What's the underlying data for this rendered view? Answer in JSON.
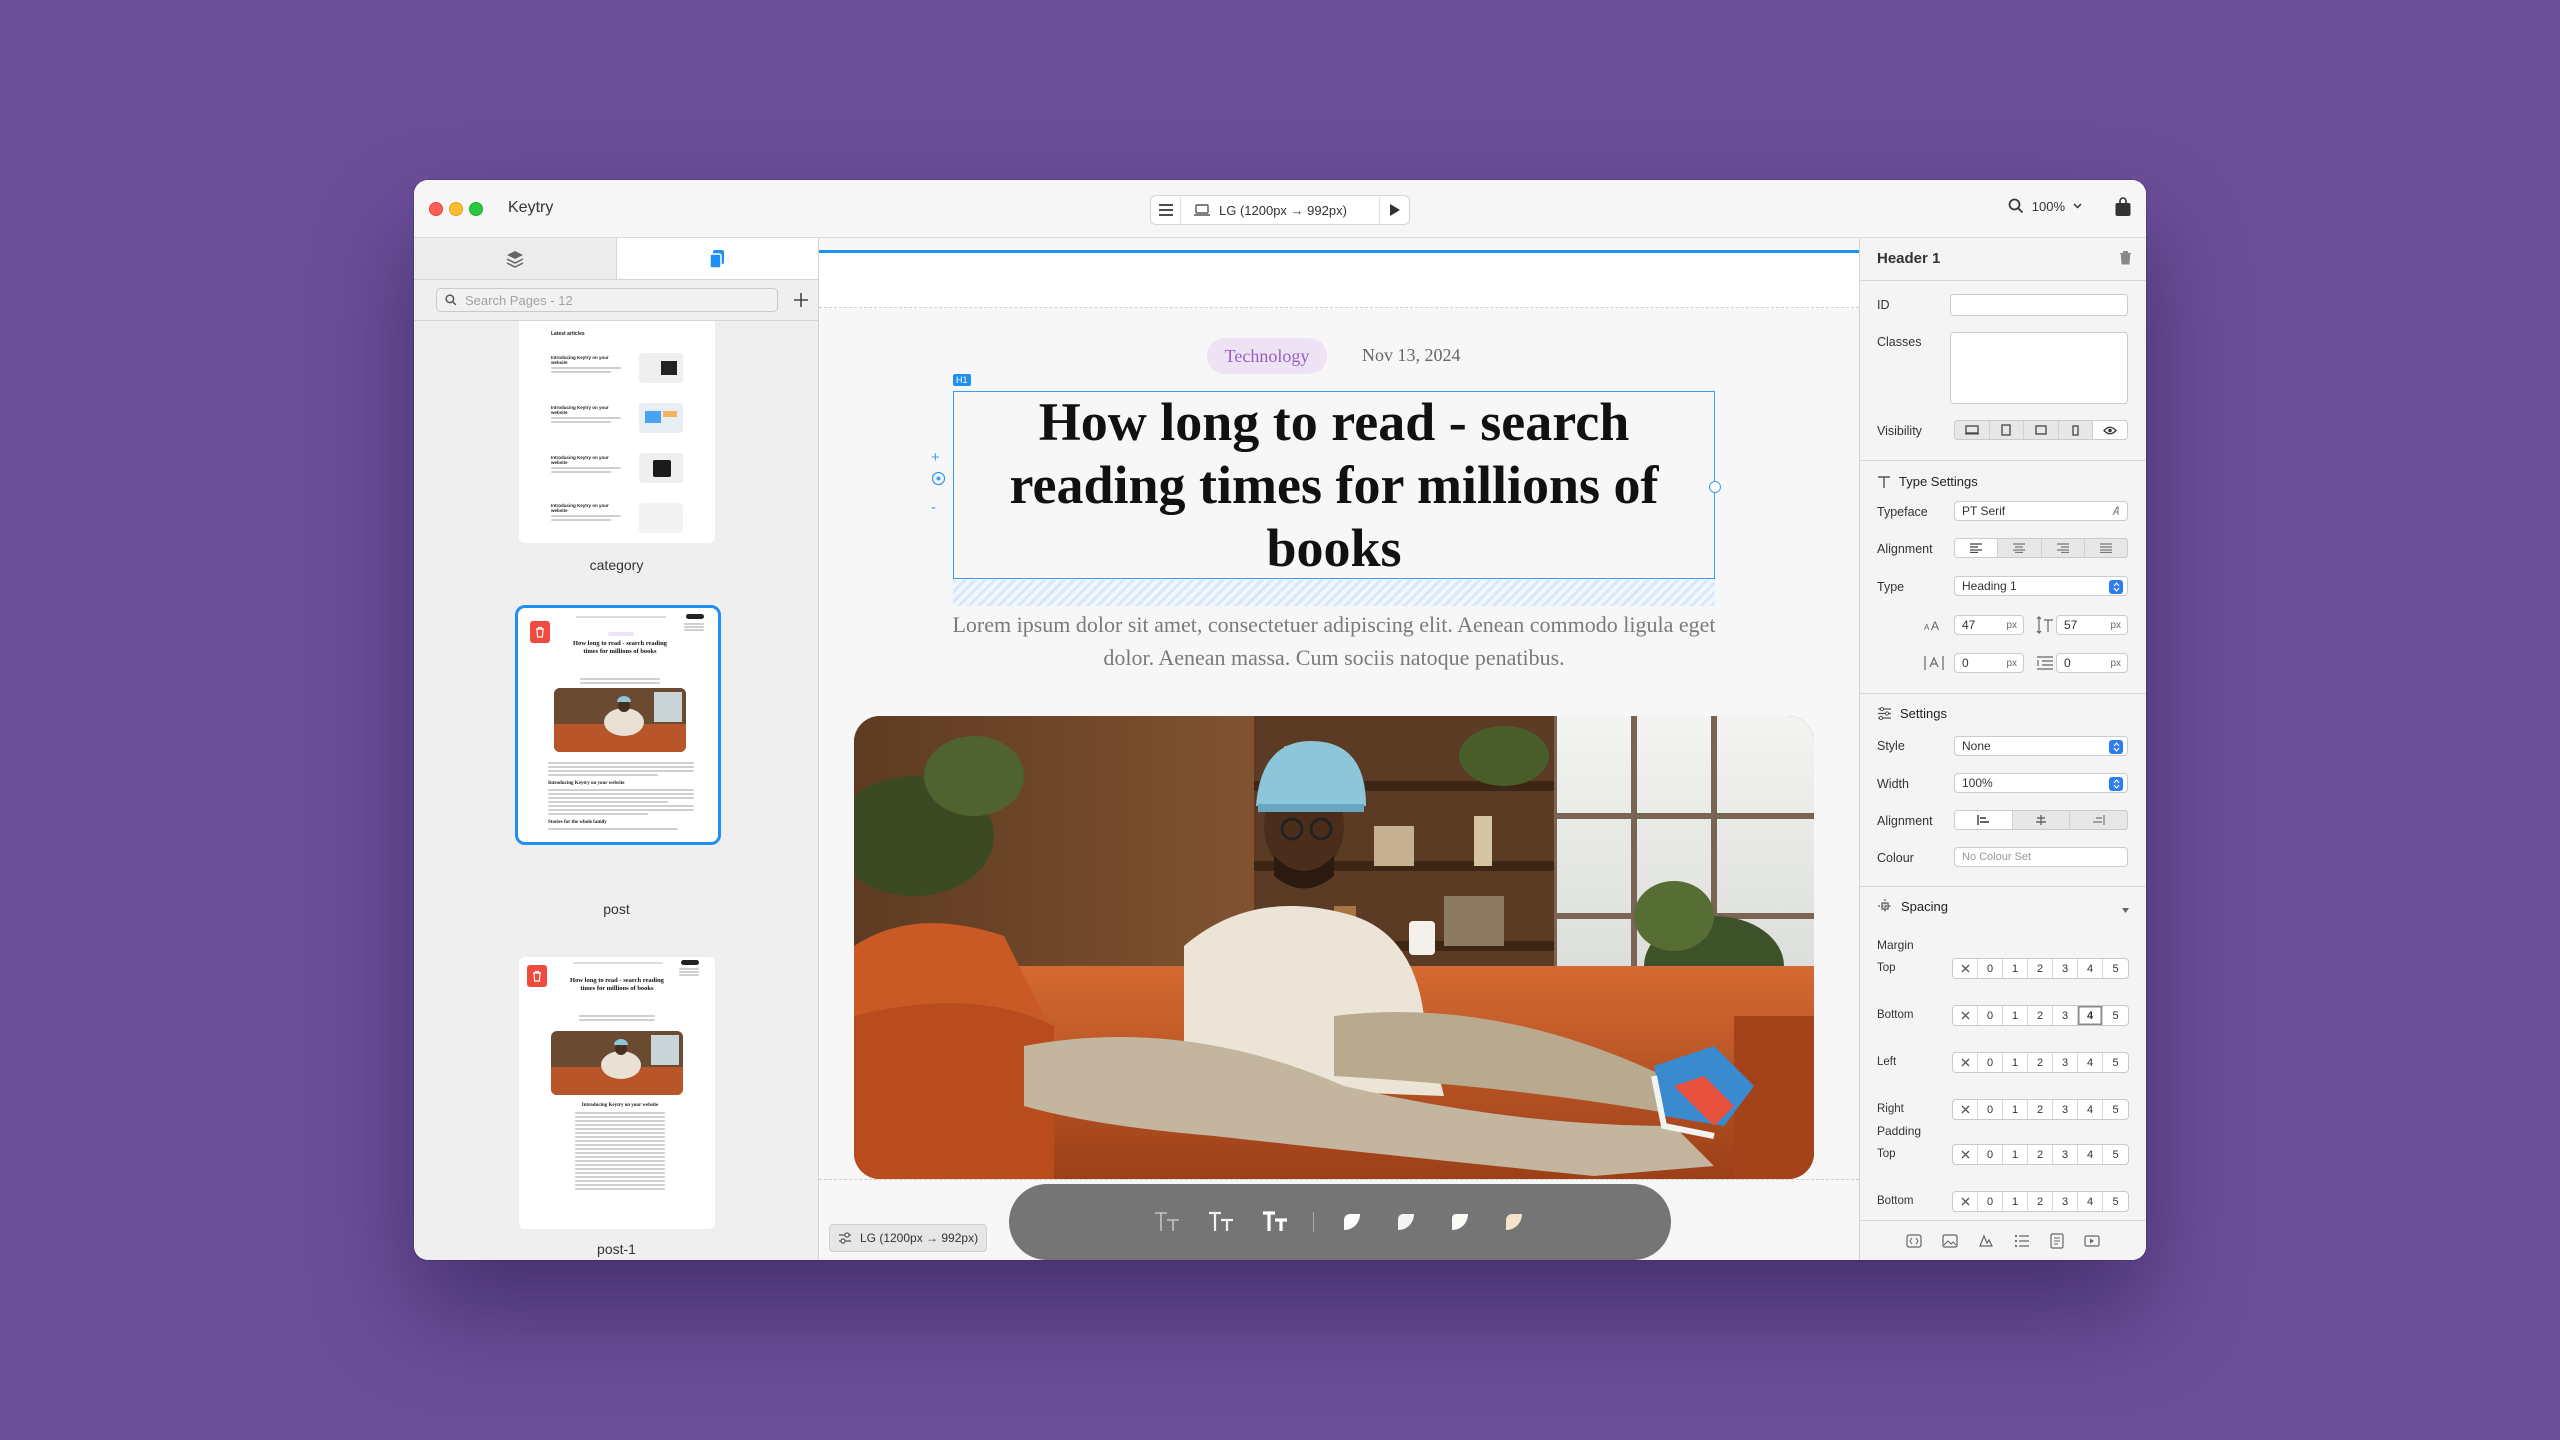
{
  "app": {
    "name": "Keytry"
  },
  "toolbar": {
    "breakpoint": "LG (1200px → 992px)",
    "zoom": "100%"
  },
  "left_panel": {
    "search_placeholder": "Search Pages - 12",
    "pages": [
      {
        "label": "category",
        "thumb_title": "Latest articles",
        "thumb_items": [
          "Introducing Keytry on your website",
          "Introducing Keytry on your website",
          "Introducing Keytry on your website",
          "Introducing Keytry on your website"
        ]
      },
      {
        "label": "post",
        "selected": true,
        "thumb_title": "How long to read - search reading times for millions of books",
        "thumb_sub1": "Introducing Keytry on your website",
        "thumb_sub2": "Stories for the whole family"
      },
      {
        "label": "post-1",
        "thumb_title": "How long to read - search reading times for millions of books",
        "thumb_sub1": "Introducing Keytry on your website"
      }
    ]
  },
  "canvas": {
    "tag": "Technology",
    "date": "Nov 13, 2024",
    "h1_badge": "H1",
    "heading": "How long to read - search reading times for millions of books",
    "lead": "Lorem ipsum dolor sit amet, consectetuer adipiscing elit. Aenean commodo ligula eget dolor. Aenean massa. Cum sociis natoque penatibus.",
    "breakpoint_badge": "LG (1200px → 992px)"
  },
  "inspector": {
    "title": "Header 1",
    "id_label": "ID",
    "id_value": "",
    "classes_label": "Classes",
    "visibility_label": "Visibility",
    "type_settings": {
      "section": "Type Settings",
      "typeface_label": "Typeface",
      "typeface": "PT Serif",
      "alignment_label": "Alignment",
      "type_label": "Type",
      "type": "Heading 1",
      "font_size": "47",
      "line_height": "57",
      "letter_spacing": "0",
      "word_spacing": "0",
      "unit": "px"
    },
    "settings": {
      "section": "Settings",
      "style_label": "Style",
      "style": "None",
      "width_label": "Width",
      "width": "100%",
      "alignment_label": "Alignment",
      "colour_label": "Colour",
      "colour_placeholder": "No Colour Set"
    },
    "spacing": {
      "section": "Spacing",
      "margin_label": "Margin",
      "padding_label": "Padding",
      "scale": [
        "0",
        "1",
        "2",
        "3",
        "4",
        "5"
      ],
      "margin_rows": [
        {
          "label": "Top",
          "active": null
        },
        {
          "label": "Bottom",
          "active": "4"
        },
        {
          "label": "Left",
          "active": null
        },
        {
          "label": "Right",
          "active": null
        }
      ],
      "padding_rows": [
        {
          "label": "Top",
          "active": null
        },
        {
          "label": "Bottom",
          "active": null
        }
      ]
    }
  },
  "colors": {
    "accent": "#1f8ff2",
    "background": "#6c4f99",
    "tag_bg": "#ede3f4",
    "tag_text": "#9b5fc0"
  }
}
